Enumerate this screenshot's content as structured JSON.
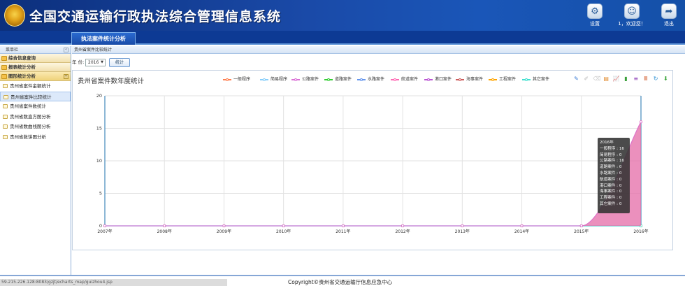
{
  "app": {
    "title": "全国交通运输行政执法综合管理信息系统",
    "settings_label": "设置",
    "user_label": "1，欢迎您！",
    "logout_label": "退出"
  },
  "nav": {
    "active_tab": "执法案件统计分析"
  },
  "sidebar": {
    "header": "菜单栏",
    "collapse": "«",
    "groups": [
      {
        "label": "综合信息查询",
        "expanded": false
      },
      {
        "label": "报表统计分析",
        "expanded": false
      },
      {
        "label": "图形统计分析",
        "expanded": true,
        "toggle": "−"
      }
    ],
    "items": [
      {
        "label": "贵州省案件金额统计",
        "active": false
      },
      {
        "label": "贵州省案件比较统计",
        "active": true
      },
      {
        "label": "贵州省案件数统计",
        "active": false
      },
      {
        "label": "贵州省数直方图分析",
        "active": false
      },
      {
        "label": "贵州省数曲线图分析",
        "active": false
      },
      {
        "label": "贵州省数饼图分析",
        "active": false
      }
    ]
  },
  "breadcrumb": "贵州省案件比较统计",
  "filter": {
    "year_label": "年 份:",
    "year_value": "2016",
    "submit_label": "统计"
  },
  "tooltip": {
    "title": "2016年",
    "rows": [
      "一般程序 : 16",
      "简易程序 : 0",
      "公路案件 : 16",
      "道路案件 : 0",
      "水路案件 : 0",
      "航道案件 : 0",
      "港口案件 : 0",
      "海事案件 : 0",
      "工程案件 : 0",
      "其它案件 : 0"
    ]
  },
  "tool_icons": [
    "mark-icon",
    "mark-undo-icon",
    "mark-clear-icon",
    "data-view-icon",
    "line-icon",
    "bar-icon",
    "stack-icon",
    "tiled-icon",
    "refresh-icon",
    "save-icon"
  ],
  "footer": {
    "copyright": "Copyright©贵州省交通运输厅信息应急中心",
    "status_url": "59.215.226.128:8083/gzjt/echarts_map/guizhou4.jsp"
  },
  "chart_data": {
    "type": "area",
    "title": "贵州省案件数年度统计",
    "categories": [
      "2007年",
      "2008年",
      "2009年",
      "2010年",
      "2011年",
      "2012年",
      "2013年",
      "2014年",
      "2015年",
      "2016年"
    ],
    "ylim": [
      0,
      20
    ],
    "yticks": [
      0,
      5,
      10,
      15,
      20
    ],
    "grid": true,
    "legend_position": "top",
    "series": [
      {
        "name": "一般程序",
        "color": "#ff7f50",
        "values": [
          0,
          0,
          0,
          0,
          0,
          0,
          0,
          0,
          0,
          16
        ]
      },
      {
        "name": "简易程序",
        "color": "#87cefa",
        "values": [
          0,
          0,
          0,
          0,
          0,
          0,
          0,
          0,
          0,
          0
        ]
      },
      {
        "name": "公路案件",
        "color": "#da70d6",
        "values": [
          0,
          0,
          0,
          0,
          0,
          0,
          0,
          0,
          0,
          16
        ]
      },
      {
        "name": "道路案件",
        "color": "#32cd32",
        "values": [
          0,
          0,
          0,
          0,
          0,
          0,
          0,
          0,
          0,
          0
        ]
      },
      {
        "name": "水路案件",
        "color": "#6495ed",
        "values": [
          0,
          0,
          0,
          0,
          0,
          0,
          0,
          0,
          0,
          0
        ]
      },
      {
        "name": "航道案件",
        "color": "#ff69b4",
        "values": [
          0,
          0,
          0,
          0,
          0,
          0,
          0,
          0,
          0,
          0
        ]
      },
      {
        "name": "港口案件",
        "color": "#ba55d3",
        "values": [
          0,
          0,
          0,
          0,
          0,
          0,
          0,
          0,
          0,
          0
        ]
      },
      {
        "name": "海事案件",
        "color": "#cd5c5c",
        "values": [
          0,
          0,
          0,
          0,
          0,
          0,
          0,
          0,
          0,
          0
        ]
      },
      {
        "name": "工程案件",
        "color": "#ffa500",
        "values": [
          0,
          0,
          0,
          0,
          0,
          0,
          0,
          0,
          0,
          0
        ]
      },
      {
        "name": "其它案件",
        "color": "#40e0d0",
        "values": [
          0,
          0,
          0,
          0,
          0,
          0,
          0,
          0,
          0,
          0
        ]
      }
    ]
  }
}
